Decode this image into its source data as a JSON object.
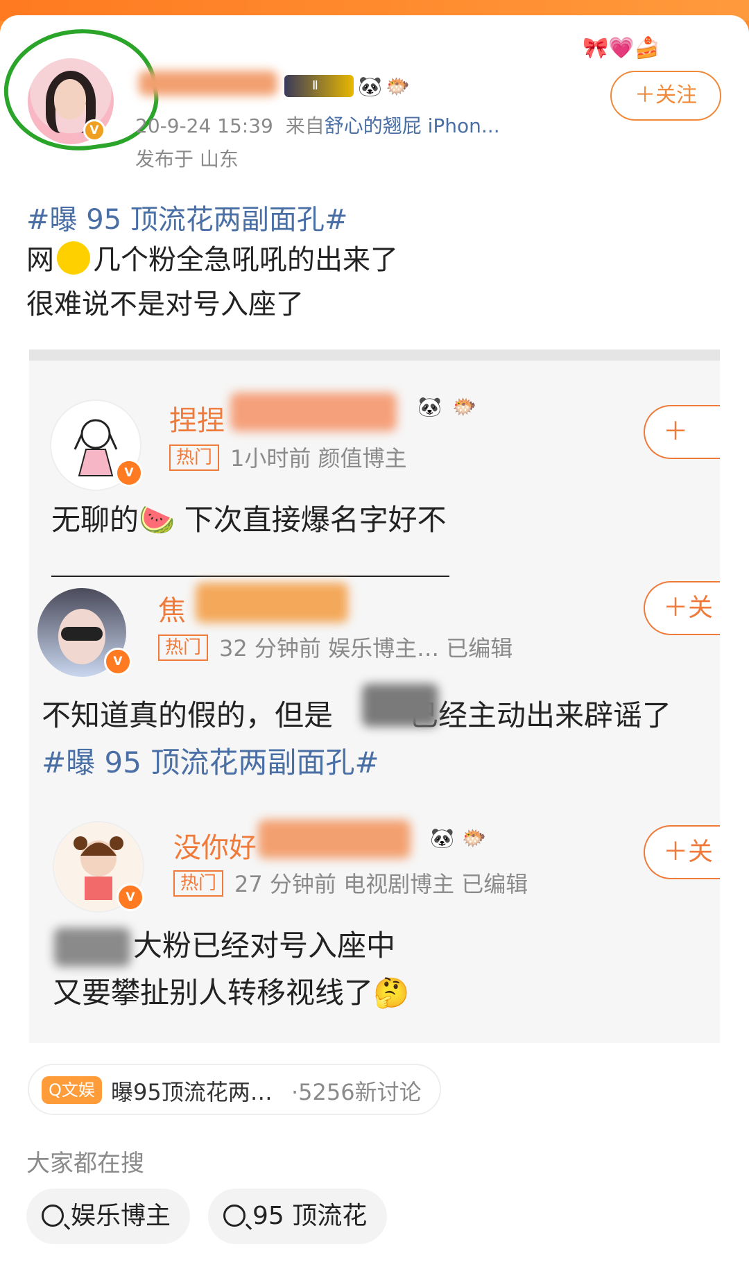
{
  "post": {
    "meta_time": "20-9-24 15:39",
    "meta_prefix": "来自",
    "meta_source": "舒心的翘屁 iPhon...",
    "location": "发布于 山东",
    "follow_label": "＋关注",
    "hashtag": "#曝 95 顶流花两副面孔#",
    "line1_a": "网",
    "line1_b": "几个粉全急吼吼的出来了",
    "line2": "很难说不是对号入座了"
  },
  "screenshot": {
    "comments": [
      {
        "name": "捏捏",
        "hot": "热门",
        "meta": "1小时前  颜值博主",
        "text_a": "无聊的",
        "text_b": "下次直接爆名字好不",
        "follow": "＋"
      },
      {
        "name": "焦",
        "hot": "热门",
        "meta": "32 分钟前  娱乐博主…  已编辑",
        "text_a": "不知道真的假的，但是",
        "text_b": "已经主动出来辟谣了",
        "tag": "#曝 95 顶流花两副面孔#",
        "follow": "＋关"
      },
      {
        "name": "没你好",
        "hot": "热门",
        "meta": "27 分钟前  电视剧博主  已编辑",
        "line1": "大粉已经对号入座中",
        "line2": "又要攀扯别人转移视线了",
        "follow": "＋关"
      }
    ]
  },
  "topic": {
    "tag": "Q文娱",
    "text": "曝95顶流花两…",
    "count": "·5256新讨论"
  },
  "search": {
    "title": "大家都在搜",
    "chips": [
      "娱乐博主",
      "95 顶流花"
    ]
  },
  "colors": {
    "accent": "#f07a3a",
    "link": "#4a6fa5",
    "annotation": "#2aa52a"
  }
}
